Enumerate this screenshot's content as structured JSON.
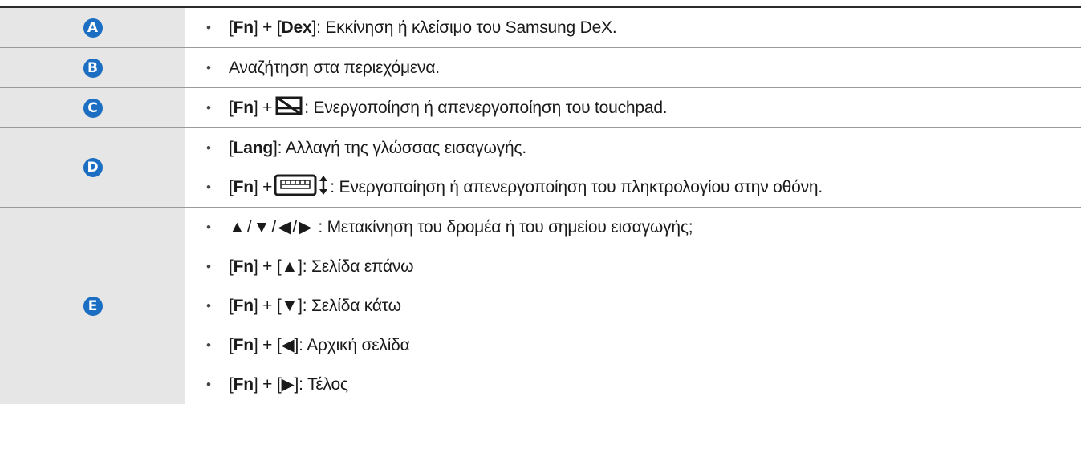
{
  "rows": [
    {
      "key": "A",
      "items": [
        {
          "pre": "[",
          "k1": "Fn",
          "mid": "] + [",
          "k2": "Dex",
          "post": "]: Εκκίνηση ή κλείσιμο του Samsung DeX."
        }
      ]
    },
    {
      "key": "B",
      "items": [
        {
          "text": "Αναζήτηση στα περιεχόμενα."
        }
      ]
    },
    {
      "key": "C",
      "items": [
        {
          "pre": "[",
          "k1": "Fn",
          "mid": "] +",
          "icon": "touchpad-off-icon",
          "post": ": Ενεργοποίηση ή απενεργοποίηση του touchpad."
        }
      ]
    },
    {
      "key": "D",
      "items": [
        {
          "pre": "[",
          "k1": "Lang",
          "post": "]: Αλλαγή της γλώσσας εισαγωγής."
        },
        {
          "pre": "[",
          "k1": "Fn",
          "mid": "] +",
          "icon": "keyboard-toggle-icon",
          "post": ": Ενεργοποίηση ή απενεργοποίηση του πληκτρολογίου στην οθόνη."
        }
      ]
    },
    {
      "key": "E",
      "items": [
        {
          "arrows": "▲/▼/◀/▶",
          "post": ": Μετακίνηση του δρομέα ή του σημείου εισαγωγής;"
        },
        {
          "pre": "[",
          "k1": "Fn",
          "mid": "] + [",
          "k2": "▲",
          "post": "]: Σελίδα επάνω"
        },
        {
          "pre": "[",
          "k1": "Fn",
          "mid": "] + [",
          "k2": "▼",
          "post": "]: Σελίδα κάτω"
        },
        {
          "pre": "[",
          "k1": "Fn",
          "mid": "] + [",
          "k2": "◀",
          "post": "]: Αρχική σελίδα"
        },
        {
          "pre": "[",
          "k1": "Fn",
          "mid": "] + [",
          "k2": "▶",
          "post": "]: Τέλος"
        }
      ]
    }
  ],
  "bullet": "•",
  "colors": {
    "badge": "#1b6ec2",
    "key_cell_bg": "#e6e6e6",
    "rule": "#9a9a9a"
  }
}
